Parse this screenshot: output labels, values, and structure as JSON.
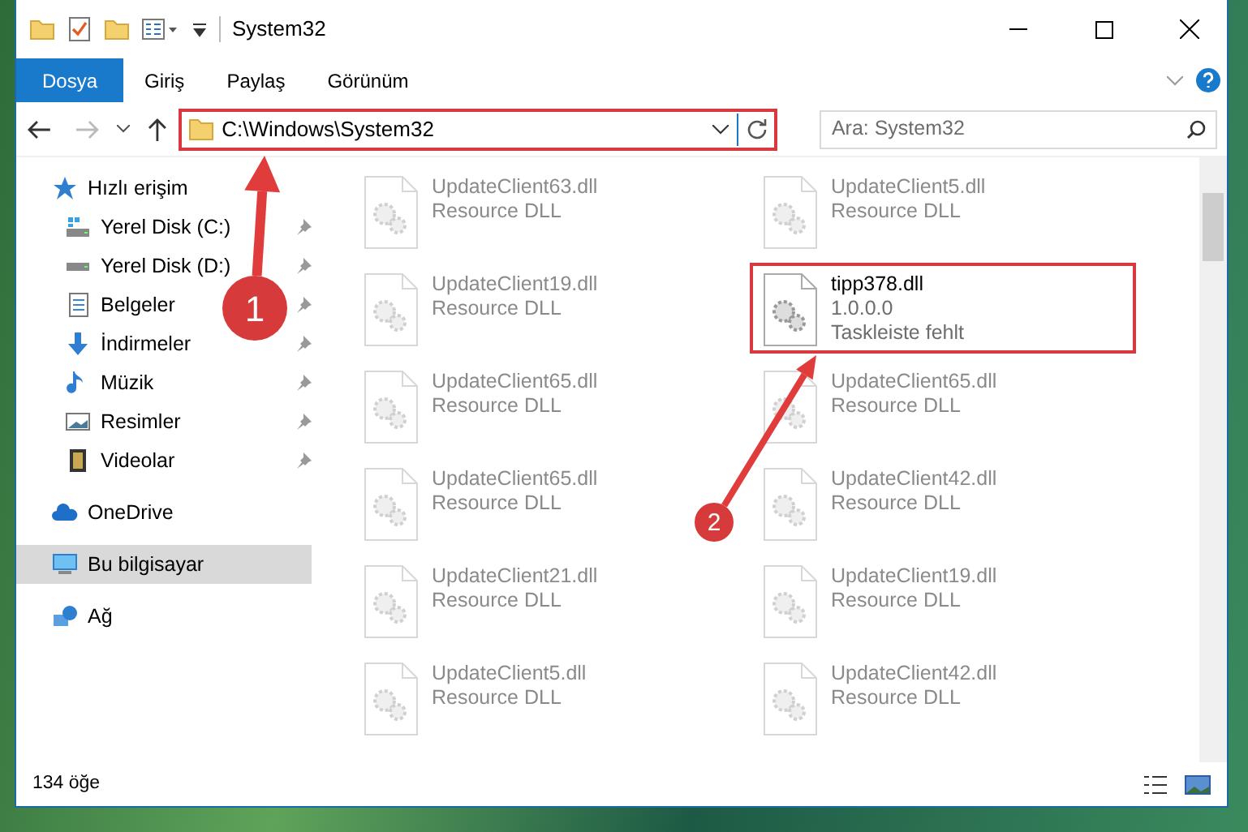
{
  "window": {
    "title": "System32"
  },
  "ribbon_tabs": [
    {
      "label": "Dosya",
      "selected": true
    },
    {
      "label": "Giriş",
      "selected": false
    },
    {
      "label": "Paylaş",
      "selected": false
    },
    {
      "label": "Görünüm",
      "selected": false
    }
  ],
  "address_bar": {
    "path": "C:\\Windows\\System32",
    "highlighted": true
  },
  "search": {
    "placeholder": "Ara: System32"
  },
  "sidebar": {
    "items": [
      {
        "label": "Hızlı erişim",
        "kind": "star",
        "selected": false,
        "children": [
          {
            "label": "Yerel Disk (C:)",
            "kind": "drive-c",
            "pinned": true,
            "selected": false
          },
          {
            "label": "Yerel Disk (D:)",
            "kind": "drive",
            "pinned": true,
            "selected": false
          },
          {
            "label": "Belgeler",
            "kind": "documents",
            "pinned": true,
            "selected": false
          },
          {
            "label": "İndirmeler",
            "kind": "downloads",
            "pinned": true,
            "selected": false
          },
          {
            "label": "Müzik",
            "kind": "music",
            "pinned": true,
            "selected": false
          },
          {
            "label": "Resimler",
            "kind": "pictures",
            "pinned": true,
            "selected": false
          },
          {
            "label": "Videolar",
            "kind": "videos",
            "pinned": true,
            "selected": false
          }
        ]
      },
      {
        "label": "OneDrive",
        "kind": "cloud",
        "selected": false
      },
      {
        "label": "Bu bilgisayar",
        "kind": "computer",
        "selected": true
      },
      {
        "label": "Ağ",
        "kind": "network",
        "selected": false
      }
    ]
  },
  "files": [
    {
      "name": "UpdateClient63.dll",
      "details": [
        "Resource DLL"
      ],
      "faded": true,
      "highlighted": false
    },
    {
      "name": "UpdateClient5.dll",
      "details": [
        "Resource DLL"
      ],
      "faded": true,
      "highlighted": false
    },
    {
      "name": "UpdateClient19.dll",
      "details": [
        "Resource DLL"
      ],
      "faded": true,
      "highlighted": false
    },
    {
      "name": "tipp378.dll",
      "details": [
        "1.0.0.0",
        "Taskleiste fehlt"
      ],
      "faded": false,
      "highlighted": true
    },
    {
      "name": "UpdateClient65.dll",
      "details": [
        "Resource DLL"
      ],
      "faded": true,
      "highlighted": false
    },
    {
      "name": "UpdateClient65.dll",
      "details": [
        "Resource DLL"
      ],
      "faded": true,
      "highlighted": false
    },
    {
      "name": "UpdateClient65.dll",
      "details": [
        "Resource DLL"
      ],
      "faded": true,
      "highlighted": false
    },
    {
      "name": "UpdateClient42.dll",
      "details": [
        "Resource DLL"
      ],
      "faded": true,
      "highlighted": false
    },
    {
      "name": "UpdateClient21.dll",
      "details": [
        "Resource DLL"
      ],
      "faded": true,
      "highlighted": false
    },
    {
      "name": "UpdateClient19.dll",
      "details": [
        "Resource DLL"
      ],
      "faded": true,
      "highlighted": false
    },
    {
      "name": "UpdateClient5.dll",
      "details": [
        "Resource DLL"
      ],
      "faded": true,
      "highlighted": false
    },
    {
      "name": "UpdateClient42.dll",
      "details": [
        "Resource DLL"
      ],
      "faded": true,
      "highlighted": false
    }
  ],
  "status_bar": {
    "item_count": "134 öğe"
  },
  "callouts": [
    {
      "number": "1"
    },
    {
      "number": "2"
    }
  ]
}
